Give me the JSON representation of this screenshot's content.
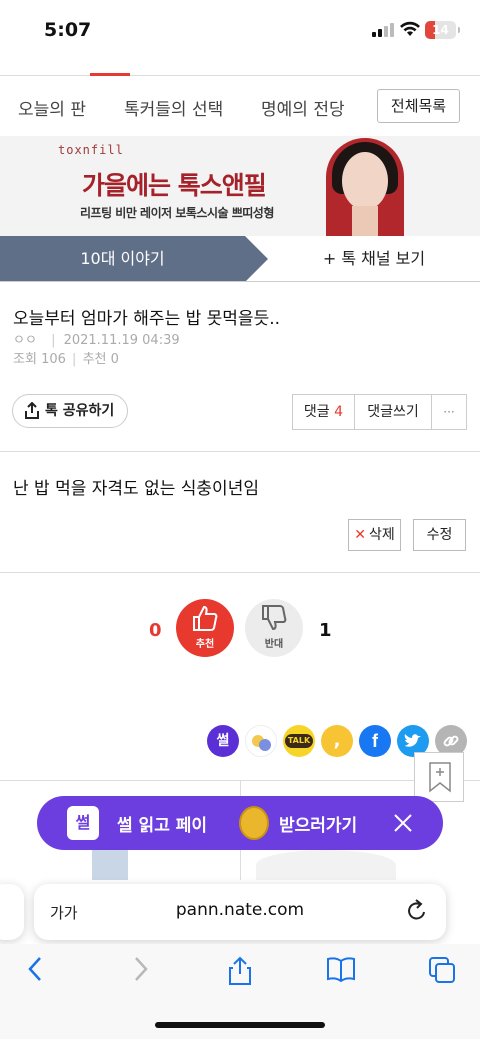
{
  "status_bar": {
    "time": "5:07",
    "battery": "14"
  },
  "nav": {
    "tabs": [
      "오늘의 판",
      "톡커들의 선택",
      "명예의 전당"
    ],
    "all_list": "전체목록"
  },
  "ad": {
    "brand": "toxnfill",
    "headline": "가을에는 톡스앤필",
    "subline": "리프팅 비만 레이저 보톡스시술 쁘띠성형"
  },
  "category": {
    "current": "10대 이야기",
    "more": "+ 톡 채널 보기"
  },
  "post": {
    "title": "오늘부터 엄마가 해주는 밥 못먹을듯..",
    "author": "ㅇㅇ",
    "date": "2021.11.19 04:39",
    "views_label": "조회",
    "views": "106",
    "recommend_label": "추천",
    "recommend": "0",
    "share_label": "톡 공유하기",
    "comments_label": "댓글",
    "comments_count": "4",
    "write_comment": "댓글쓰기",
    "more": "···",
    "body": "난 밥 먹을 자격도 없는 식충이년임",
    "delete_label": "삭제",
    "edit_label": "수정"
  },
  "vote": {
    "up_count": "0",
    "up_label": "추천",
    "down_label": "반대",
    "down_count": "1"
  },
  "social": {
    "ssul": "썰",
    "talk": "TALK",
    "facebook": "f"
  },
  "promo": {
    "logo": "썰",
    "text1": "썰 읽고 페이",
    "text2": "받으러가기"
  },
  "browser": {
    "aa": "가가",
    "url": "pann.nate.com"
  },
  "colors": {
    "accent": "#e8392f",
    "category_bar": "#5f6f87",
    "promo": "#6c3ee0"
  }
}
